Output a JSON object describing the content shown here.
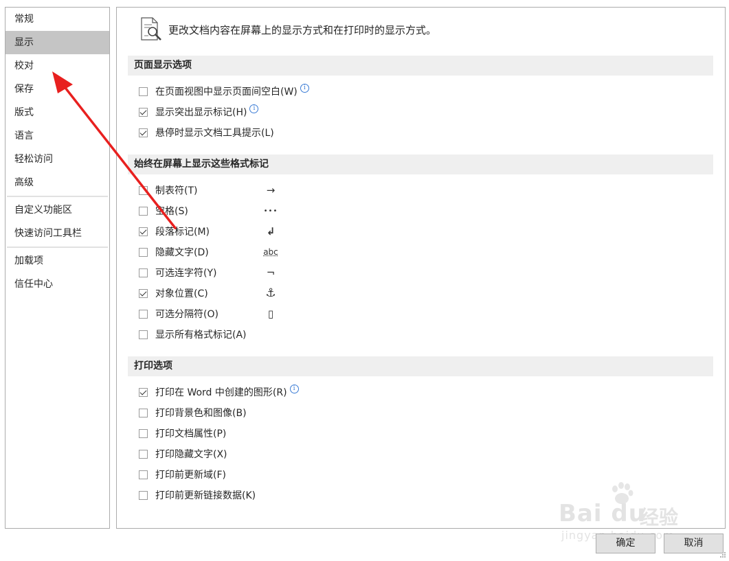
{
  "sidebar": {
    "items": [
      {
        "label": "常规",
        "selected": false
      },
      {
        "label": "显示",
        "selected": true
      },
      {
        "label": "校对",
        "selected": false
      },
      {
        "label": "保存",
        "selected": false
      },
      {
        "label": "版式",
        "selected": false
      },
      {
        "label": "语言",
        "selected": false
      },
      {
        "label": "轻松访问",
        "selected": false
      },
      {
        "label": "高级",
        "selected": false
      },
      {
        "label": "自定义功能区",
        "selected": false
      },
      {
        "label": "快速访问工具栏",
        "selected": false
      },
      {
        "label": "加载项",
        "selected": false
      },
      {
        "label": "信任中心",
        "selected": false
      }
    ]
  },
  "header": {
    "text": "更改文档内容在屏幕上的显示方式和在打印时的显示方式。",
    "icon": "document-magnifier-icon"
  },
  "sections": {
    "page_display": {
      "title": "页面显示选项",
      "options": [
        {
          "label": "在页面视图中显示页面间空白(W)",
          "checked": false,
          "info": true
        },
        {
          "label": "显示突出显示标记(H)",
          "checked": true,
          "info": true
        },
        {
          "label": "悬停时显示文档工具提示(L)",
          "checked": true,
          "info": false
        }
      ]
    },
    "format_marks": {
      "title": "始终在屏幕上显示这些格式标记",
      "options": [
        {
          "label": "制表符(T)",
          "checked": false,
          "symbol": "→"
        },
        {
          "label": "空格(S)",
          "checked": false,
          "symbol": "•••"
        },
        {
          "label": "段落标记(M)",
          "checked": true,
          "symbol": "↲"
        },
        {
          "label": "隐藏文字(D)",
          "checked": false,
          "symbol": "abc"
        },
        {
          "label": "可选连字符(Y)",
          "checked": false,
          "symbol": "¬"
        },
        {
          "label": "对象位置(C)",
          "checked": true,
          "symbol": "⚓"
        },
        {
          "label": "可选分隔符(O)",
          "checked": false,
          "symbol": "▯"
        },
        {
          "label": "显示所有格式标记(A)",
          "checked": false,
          "symbol": ""
        }
      ]
    },
    "print": {
      "title": "打印选项",
      "options": [
        {
          "label": "打印在 Word 中创建的图形(R)",
          "checked": true,
          "info": true
        },
        {
          "label": "打印背景色和图像(B)",
          "checked": false,
          "info": false
        },
        {
          "label": "打印文档属性(P)",
          "checked": false,
          "info": false
        },
        {
          "label": "打印隐藏文字(X)",
          "checked": false,
          "info": false
        },
        {
          "label": "打印前更新域(F)",
          "checked": false,
          "info": false
        },
        {
          "label": "打印前更新链接数据(K)",
          "checked": false,
          "info": false
        }
      ]
    }
  },
  "buttons": {
    "ok": "确定",
    "cancel": "取消"
  },
  "info_glyph": "i",
  "watermark": {
    "brand": "Bai du",
    "cn": "经验",
    "url": "jingyan.baidu.com"
  },
  "colors": {
    "arrow": "#e8201f",
    "selected_bg": "#c5c5c5",
    "section_bg": "#efefef"
  }
}
